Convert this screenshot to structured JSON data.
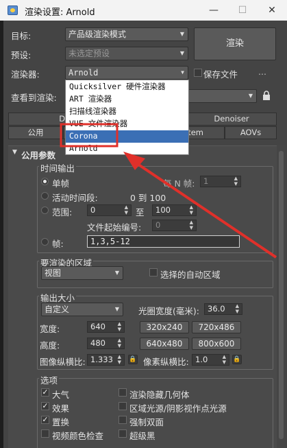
{
  "window": {
    "title": "渲染设置: Arnold",
    "minimize": "—",
    "maximize": "☐",
    "close": "✕"
  },
  "top": {
    "target_label": "目标:",
    "target_value": "产品级渲染模式",
    "preset_label": "预设:",
    "preset_value": "未选定预设",
    "renderer_label": "渲染器:",
    "renderer_value": "Arnold",
    "save_file_label": "保存文件",
    "more_label": "...",
    "render_button": "渲染",
    "view_label": "查看到渲染:"
  },
  "dropdown": {
    "options": [
      "Quicksilver 硬件渲染器",
      "ART 渲染器",
      "扫描线渲染器",
      "VUE 文件渲染器",
      "Corona",
      "Arnold"
    ],
    "selected_index": 4
  },
  "tabs_row1": [
    "Diagnos",
    "Denoiser"
  ],
  "tabs_row2": [
    "公用",
    "stem",
    "AOVs"
  ],
  "panel": {
    "rollout_title": "公用参数",
    "time_output": {
      "title": "时间输出",
      "single": "单帧",
      "every_n": "每 N 帧:",
      "every_n_value": "1",
      "active_segment": "活动时间段:",
      "active_segment_value": "0 到 100",
      "range": "范围:",
      "range_from": "0",
      "range_to_label": "至",
      "range_to": "100",
      "file_start": "文件起始编号:",
      "file_start_value": "0",
      "frames": "帧:",
      "frames_value": "1,3,5-12"
    },
    "render_area": {
      "title": "要渲染的区域",
      "mode": "视图",
      "auto_region": "选择的自动区域"
    },
    "output_size": {
      "title": "输出大小",
      "preset": "自定义",
      "aperture_label": "光圈宽度(毫米):",
      "aperture_value": "36.0",
      "width_label": "宽度:",
      "width_value": "640",
      "height_label": "高度:",
      "height_value": "480",
      "sizes": [
        "320x240",
        "720x486",
        "640x480",
        "800x600"
      ],
      "image_aspect_label": "图像纵横比:",
      "image_aspect_value": "1.333",
      "pixel_aspect_label": "像素纵横比:",
      "pixel_aspect_value": "1.0"
    },
    "options": {
      "title": "选项",
      "items": [
        {
          "label": "大气",
          "checked": true
        },
        {
          "label": "渲染隐藏几何体",
          "checked": false
        },
        {
          "label": "效果",
          "checked": true
        },
        {
          "label": "区域光源/阴影视作点光源",
          "checked": false
        },
        {
          "label": "置换",
          "checked": true
        },
        {
          "label": "强制双面",
          "checked": false
        },
        {
          "label": "视频颜色检查",
          "checked": false
        },
        {
          "label": "超级黑",
          "checked": false
        }
      ]
    }
  },
  "colors": {
    "highlight_box": "#e0302a",
    "arrow": "#e0302a",
    "selection": "#3b6fb5"
  }
}
